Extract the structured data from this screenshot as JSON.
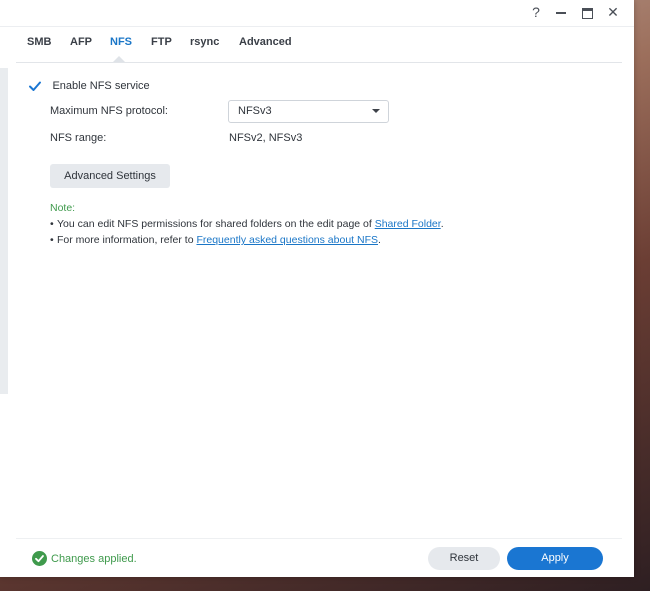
{
  "titlebar": {
    "help": "?",
    "close": "✕"
  },
  "tabs": [
    {
      "label": "SMB"
    },
    {
      "label": "AFP"
    },
    {
      "label": "NFS",
      "active": true
    },
    {
      "label": "FTP"
    },
    {
      "label": "rsync"
    },
    {
      "label": "Advanced"
    }
  ],
  "nfs": {
    "enable_label": "Enable NFS service",
    "enabled": true,
    "max_protocol_label": "Maximum NFS protocol:",
    "max_protocol_value": "NFSv3",
    "range_label": "NFS range:",
    "range_value": "NFSv2, NFSv3",
    "advanced_button": "Advanced Settings"
  },
  "note": {
    "title": "Note:",
    "bullet1_text": "You can edit NFS permissions for shared folders on the edit page of ",
    "bullet1_link": "Shared Folder",
    "bullet1_end": ".",
    "bullet2_text": "For more information, refer to ",
    "bullet2_link": "Frequently asked questions about NFS",
    "bullet2_end": "."
  },
  "footer": {
    "status": "Changes applied.",
    "reset": "Reset",
    "apply": "Apply"
  },
  "colors": {
    "accent": "#1a76d2",
    "success": "#3f9a4c"
  }
}
